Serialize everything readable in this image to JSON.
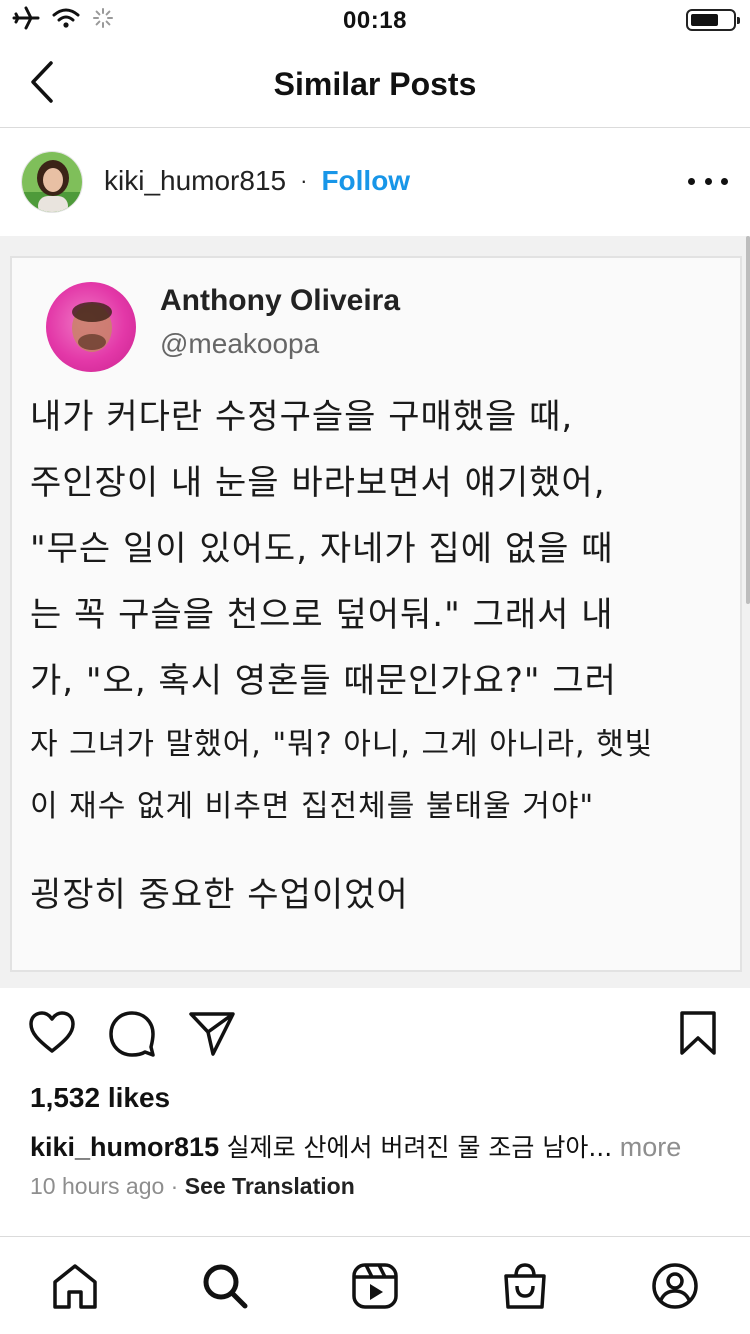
{
  "status_bar": {
    "time": "00:18",
    "icons": [
      "airplane-icon",
      "wifi-icon",
      "activity-spinner-icon",
      "battery-icon"
    ]
  },
  "nav": {
    "title": "Similar Posts",
    "back_icon": "chevron-left-icon"
  },
  "post": {
    "username": "kiki_humor815",
    "separator": "·",
    "follow_label": "Follow",
    "more_icon": "more-horizontal-icon",
    "image": {
      "tweet_name": "Anthony Oliveira",
      "tweet_handle": "@meakoopa",
      "lines": [
        "내가 커다란 수정구슬을 구매했을 때,",
        "주인장이 내 눈을 바라보면서 얘기했어,",
        "\"무슨 일이 있어도, 자네가 집에 없을 때",
        "는 꼭 구슬을 천으로 덮어둬.\" 그래서 내",
        "가, \"오, 혹시 영혼들 때문인가요?\" 그러",
        "자 그녀가 말했어, \"뭐? 아니, 그게 아니라, 햇빛",
        "이 재수 없게 비추면 집전체를 불태울 거야\"",
        "굉장히 중요한 수업이었어"
      ]
    },
    "actions": [
      "heart-icon",
      "comment-icon",
      "share-icon",
      "bookmark-icon"
    ],
    "likes": "1,532 likes",
    "caption_user": "kiki_humor815",
    "caption_text": "실제로 산에서 버려진 물 조금 남아...",
    "caption_more": "more",
    "time_ago": "10 hours ago",
    "meta_separator": "·",
    "see_translation": "See Translation"
  },
  "tabbar": {
    "tabs": [
      "home-icon",
      "search-icon",
      "reels-icon",
      "shop-icon",
      "profile-icon"
    ]
  },
  "colors": {
    "accent": "#1896e8",
    "muted": "#8e8e8e",
    "divider": "#dbdbdb",
    "tweet_avatar": "#e338a8"
  }
}
